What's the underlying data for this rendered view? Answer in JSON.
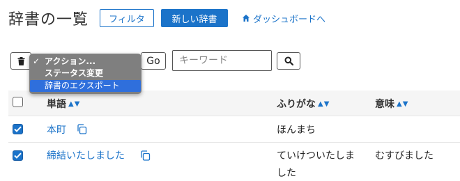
{
  "page": {
    "title": "辞書の一覧",
    "filter_label": "フィルタ",
    "new_dictionary_label": "新しい辞書",
    "dashboard_link_label": "ダッシュボードへ"
  },
  "actions": {
    "go_label": "Go",
    "keyword_placeholder": "キーワード",
    "dropdown_items": [
      {
        "label": "アクション...",
        "checked": true
      },
      {
        "label": "ステータス変更",
        "checked": false
      },
      {
        "label": "辞書のエクスポート",
        "checked": false,
        "highlighted": true
      }
    ]
  },
  "table": {
    "headers": [
      {
        "label": "単語",
        "sort": "▲▼"
      },
      {
        "label": "ふりがな",
        "sort": "▲▼"
      },
      {
        "label": "意味",
        "sort": "▲▼"
      }
    ],
    "rows": [
      {
        "checked": true,
        "word": "本町",
        "furigana": "ほんまち",
        "meaning": ""
      },
      {
        "checked": true,
        "word": "締結いたしました",
        "furigana_line1": "ていけついたしま",
        "furigana_line2": "した",
        "meaning": "むすびました"
      }
    ]
  },
  "colors": {
    "accent": "#1b73c9",
    "dropdown_bg": "#7f7f7f",
    "dropdown_highlight": "#2f6fdc"
  },
  "icons": [
    "home-icon",
    "trash-icon",
    "search-icon",
    "copy-icon",
    "check-icon"
  ]
}
